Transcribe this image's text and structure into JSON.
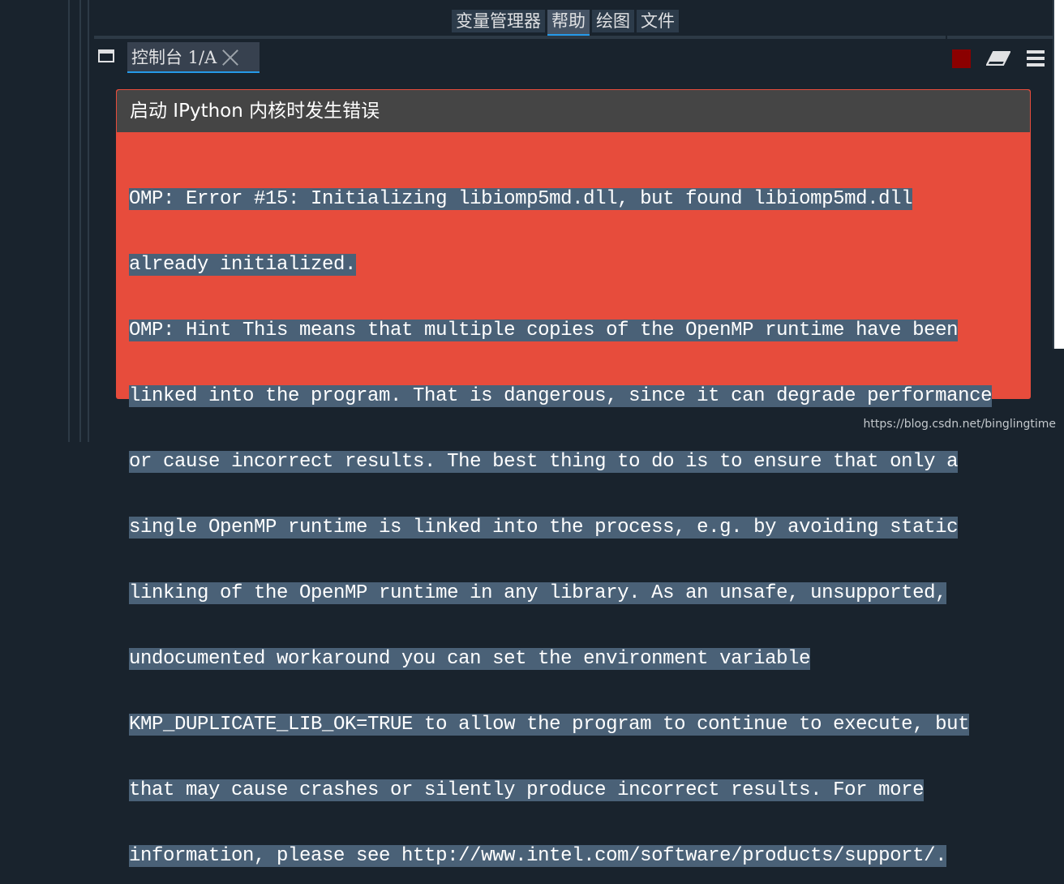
{
  "dock_tabs": [
    {
      "label": "变量管理器",
      "active": false
    },
    {
      "label": "帮助",
      "active": true
    },
    {
      "label": "绘图",
      "active": false
    },
    {
      "label": "文件",
      "active": false
    }
  ],
  "console": {
    "tab_label": "控制台 1/A",
    "toolbar": {
      "undock_icon": "undock-icon",
      "stop_icon": "stop-icon",
      "clear_icon": "eraser-icon",
      "options_icon": "hamburger-menu-icon"
    }
  },
  "error": {
    "title": "启动 IPython 内核时发生错误",
    "lines": [
      "OMP: Error #15: Initializing libiomp5md.dll, but found libiomp5md.dll",
      "already initialized.",
      "OMP: Hint This means that multiple copies of the OpenMP runtime have been",
      "linked into the program. That is dangerous, since it can degrade performance",
      "or cause incorrect results. The best thing to do is to ensure that only a",
      "single OpenMP runtime is linked into the process, e.g. by avoiding static",
      "linking of the OpenMP runtime in any library. As an unsafe, unsupported,",
      "undocumented workaround you can set the environment variable",
      "KMP_DUPLICATE_LIB_OK=TRUE to allow the program to continue to execute, but",
      "that may cause crashes or silently produce incorrect results. For more",
      "information, please see http://www.intel.com/software/products/support/."
    ]
  },
  "watermark": "https://blog.csdn.net/binglingtime",
  "colors": {
    "background": "#19232d",
    "error_panel": "#e74c3c",
    "error_header": "#454545",
    "selection": "#4a6177",
    "accent": "#259ae9",
    "stop": "#8b0000"
  }
}
